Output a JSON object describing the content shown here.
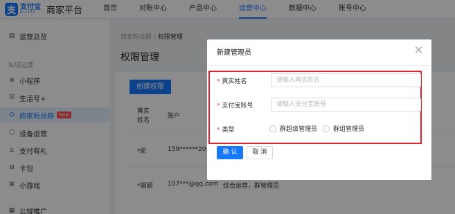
{
  "topnav": {
    "logo_glyph": "支",
    "logo_cn": "支付宝",
    "logo_en": "ALIPAY",
    "brand": "商家平台",
    "items": [
      "首页",
      "对账中心",
      "产品中心",
      "运营中心",
      "数据中心",
      "账号中心"
    ],
    "active_index": 3
  },
  "sidebar": {
    "items": [
      {
        "icon": "overview-icon",
        "glyph": "▤",
        "label": "运营总览"
      },
      {
        "icon": "mini-program-icon",
        "glyph": "⊗",
        "label": "小程序"
      },
      {
        "icon": "life-plus-icon",
        "glyph": "☒",
        "label": "生活号+"
      },
      {
        "icon": "fan-group-icon",
        "glyph": "⛭",
        "label": "商家粉丝群",
        "badge": "New"
      },
      {
        "icon": "device-icon",
        "glyph": "☐",
        "label": "设备运营"
      },
      {
        "icon": "alipay-gift-icon",
        "glyph": "⌂",
        "label": "支付有礼"
      },
      {
        "icon": "card-pack-icon",
        "glyph": "⊟",
        "label": "卡包"
      },
      {
        "icon": "mini-game-icon",
        "glyph": "⌘",
        "label": "小游戏"
      },
      {
        "icon": "domain-promo-icon",
        "glyph": "▦",
        "label": "公域推广"
      }
    ],
    "group_label": "私域运营",
    "active_index": 3
  },
  "breadcrumb": {
    "parent": "商家粉丝群",
    "separator": "/",
    "current": "权限管理"
  },
  "page_title": "权限管理",
  "create_button": "创建权限",
  "table": {
    "headers": [
      "真实\n姓名",
      "账户"
    ],
    "rows": [
      {
        "name": "*凯",
        "account": "159******20"
      },
      {
        "name": "*娟娟",
        "account": "107***@qq.com",
        "role": "综合运营，群管理员"
      }
    ]
  },
  "modal": {
    "title": "新建管理员",
    "fields": {
      "real_name": {
        "label": "真实姓名",
        "placeholder": "请输入真实姓名"
      },
      "alipay_account": {
        "label": "支付宝账号",
        "placeholder": "请输入支付宝账号"
      },
      "type": {
        "label": "类型",
        "options": [
          "群超级管理员",
          "群组管理员"
        ]
      }
    },
    "required_mark": "*",
    "ok": "确 认",
    "cancel": "取 消"
  },
  "colors": {
    "primary": "#1677ff",
    "required": "#ff4d4f",
    "highlight": "#e0202c"
  }
}
